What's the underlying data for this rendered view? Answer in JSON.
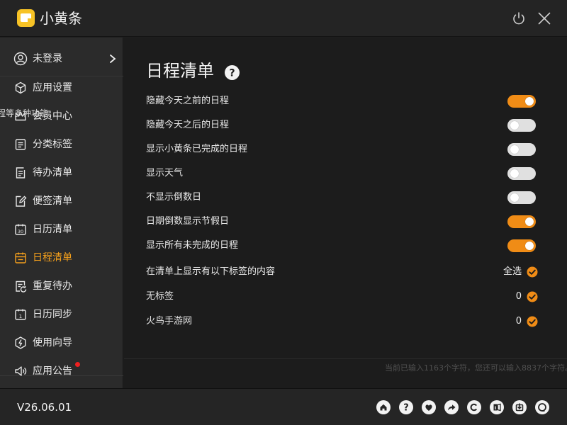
{
  "app": {
    "title": "小黄条"
  },
  "sidebar": {
    "user": {
      "label": "未登录"
    },
    "ghost_text": "程等多种功能。",
    "items": [
      {
        "label": "应用设置",
        "icon": "cube-icon"
      },
      {
        "label": "会员中心",
        "icon": "crown-icon"
      },
      {
        "label": "分类标签",
        "icon": "list-icon"
      },
      {
        "label": "待办清单",
        "icon": "todo-icon"
      },
      {
        "label": "便签清单",
        "icon": "note-edit-icon"
      },
      {
        "label": "日历清单",
        "icon": "calendar-30-icon"
      },
      {
        "label": "日程清单",
        "icon": "schedule-icon",
        "active": true
      },
      {
        "label": "重复待办",
        "icon": "repeat-icon"
      },
      {
        "label": "日历同步",
        "icon": "calendar-sync-icon"
      },
      {
        "label": "使用向导",
        "icon": "compass-icon"
      },
      {
        "label": "应用公告",
        "icon": "speaker-icon",
        "badge": true
      }
    ]
  },
  "main": {
    "title": "日程清单",
    "settings": [
      {
        "label": "隐藏今天之前的日程",
        "on": true
      },
      {
        "label": "隐藏今天之后的日程",
        "on": false
      },
      {
        "label": "显示小黄条已完成的日程",
        "on": false
      },
      {
        "label": "显示天气",
        "on": false
      },
      {
        "label": "不显示倒数日",
        "on": false
      },
      {
        "label": "日期倒数显示节假日",
        "on": true
      },
      {
        "label": "显示所有未完成的日程",
        "on": true
      }
    ],
    "tags_header": {
      "label": "在清单上显示有以下标签的内容",
      "value": "全选"
    },
    "tags": [
      {
        "label": "无标签",
        "count": "0"
      },
      {
        "label": "火鸟手游网",
        "count": "0"
      }
    ],
    "ghost_status": "当前已输入1163个字符，您还可以输入8837个字符。"
  },
  "footer": {
    "version": "V26.06.01",
    "icons": [
      "home-icon",
      "help-icon",
      "heart-icon",
      "share-icon",
      "copyright-icon",
      "ie-icon",
      "download-icon",
      "support-icon"
    ]
  },
  "colors": {
    "accent": "#f08c16",
    "toggle_off": "#e0e0e0",
    "badge": "#ee2020",
    "logo": "#f7c326"
  }
}
